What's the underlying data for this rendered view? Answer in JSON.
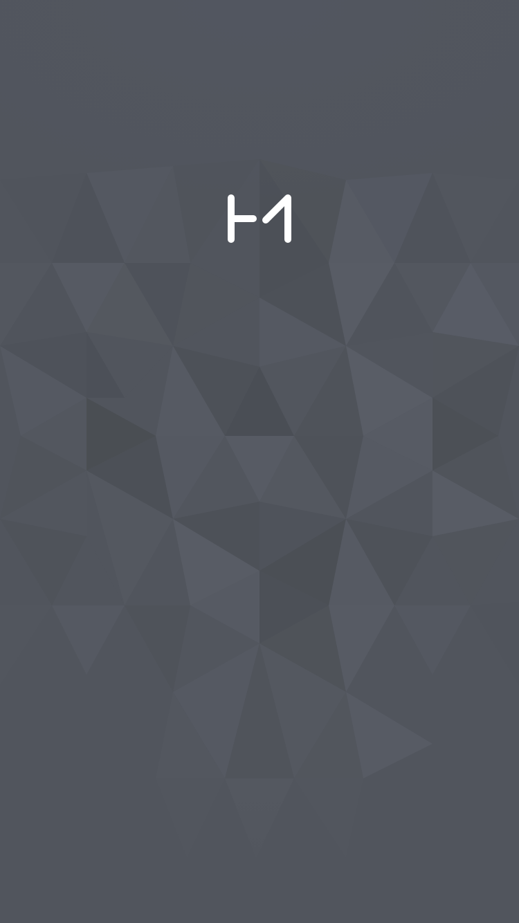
{
  "screen": {
    "name": "splash-screen",
    "background_color": "#51555d",
    "logo_color": "#ffffff",
    "logo_icon": "brand-logo-icon"
  }
}
